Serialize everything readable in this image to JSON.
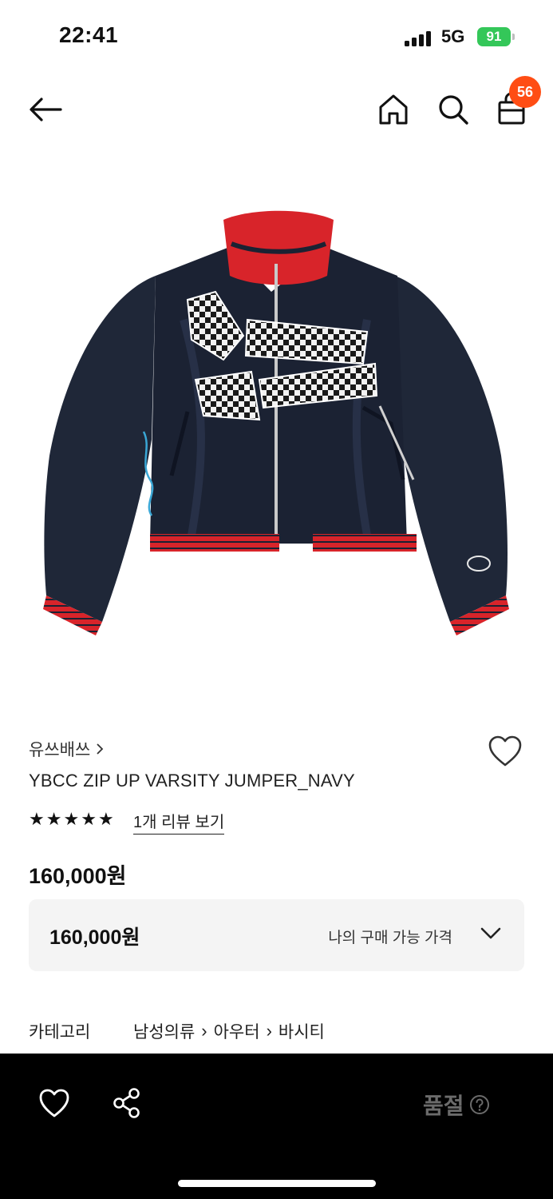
{
  "status_bar": {
    "time": "22:41",
    "network": "5G",
    "battery": "91"
  },
  "header": {
    "cart_count": "56",
    "icons": [
      "back-arrow-icon",
      "home-icon",
      "search-icon",
      "bag-icon"
    ]
  },
  "product": {
    "brand": "유쓰배쓰",
    "name": "YBCC ZIP UP VARSITY JUMPER_NAVY",
    "rating": 5,
    "review_link": "1개 리뷰 보기",
    "price": "160,000원"
  },
  "price_box": {
    "price": "160,000원",
    "label": "나의 구매 가능 가격"
  },
  "category": {
    "label": "카테고리",
    "path": [
      "남성의류",
      "아우터",
      "바시티"
    ]
  },
  "bottom_bar": {
    "status": "품절",
    "icons": [
      "heart-icon",
      "share-icon",
      "help-icon"
    ]
  },
  "colors": {
    "badge": "#ff4d14",
    "battery": "#34c759",
    "jacket": "#1b2233",
    "rib": "#d8242a"
  }
}
